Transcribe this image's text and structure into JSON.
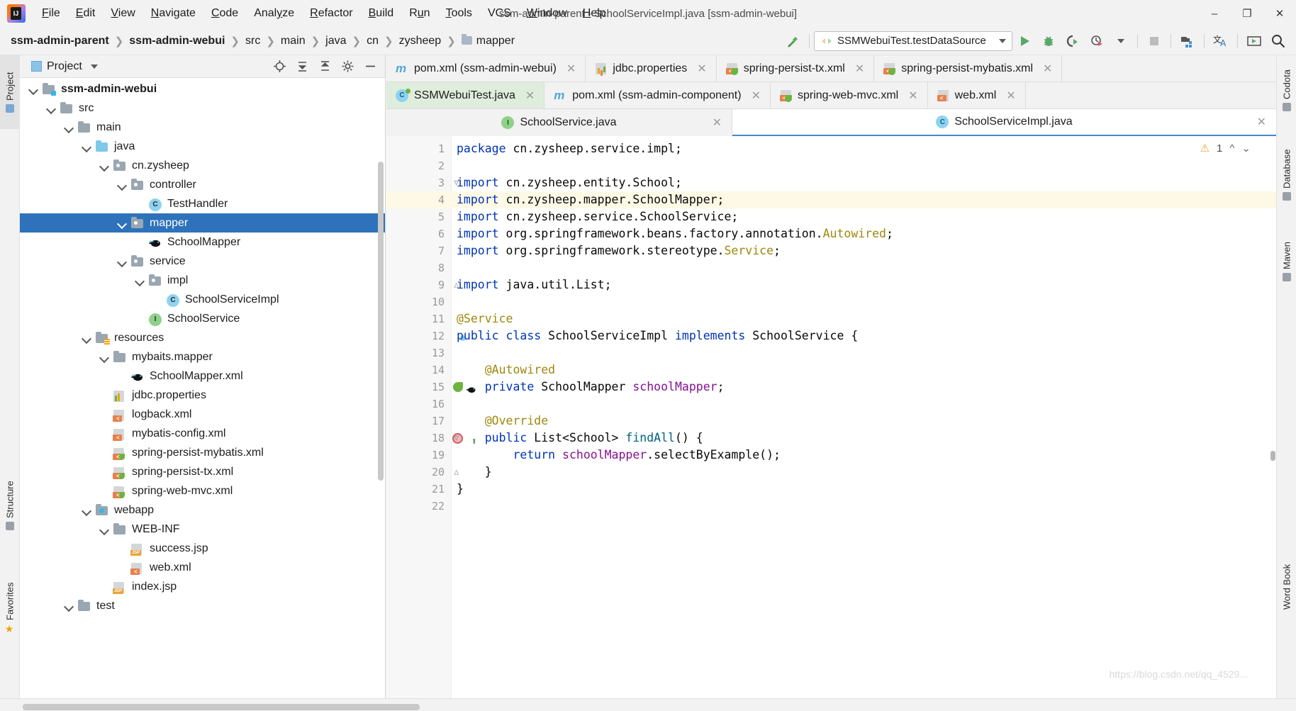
{
  "window": {
    "title": "ssm-admin-parent - SchoolServiceImpl.java [ssm-admin-webui]",
    "minimize": "–",
    "maximize": "❐",
    "close": "✕",
    "logo": "intellij-idea-logo"
  },
  "menu": {
    "items": [
      {
        "label": "File",
        "mnemonic": "F"
      },
      {
        "label": "Edit",
        "mnemonic": "E"
      },
      {
        "label": "View",
        "mnemonic": "V"
      },
      {
        "label": "Navigate",
        "mnemonic": "N"
      },
      {
        "label": "Code",
        "mnemonic": "C"
      },
      {
        "label": "Analyze",
        "mnemonic": "y"
      },
      {
        "label": "Refactor",
        "mnemonic": "R"
      },
      {
        "label": "Build",
        "mnemonic": "B"
      },
      {
        "label": "Run",
        "mnemonic": "u"
      },
      {
        "label": "Tools",
        "mnemonic": "T"
      },
      {
        "label": "VCS",
        "mnemonic": ""
      },
      {
        "label": "Window",
        "mnemonic": "W"
      },
      {
        "label": "Help",
        "mnemonic": "H"
      }
    ]
  },
  "breadcrumbs": [
    {
      "label": "ssm-admin-parent",
      "bold": true,
      "folder": false
    },
    {
      "label": "ssm-admin-webui",
      "bold": true,
      "folder": false
    },
    {
      "label": "src",
      "bold": false,
      "folder": false
    },
    {
      "label": "main",
      "bold": false,
      "folder": false
    },
    {
      "label": "java",
      "bold": false,
      "folder": false
    },
    {
      "label": "cn",
      "bold": false,
      "folder": false
    },
    {
      "label": "zysheep",
      "bold": false,
      "folder": false
    },
    {
      "label": "mapper",
      "bold": false,
      "folder": true
    }
  ],
  "toolbar": {
    "build_icon": "hammer-icon",
    "run_config": "SSMWebuiTest.testDataSource",
    "run_icon": "run-icon",
    "debug_icon": "debug-icon",
    "run_coverage_icon": "run-with-coverage-icon",
    "profile_icon": "profiler-icon",
    "dropdown_icon": "chevron-down-icon",
    "stop_icon": "stop-icon",
    "project_structure_icon": "project-structure-icon",
    "translate_icon": "translate-icon",
    "tomcat_icon": "deploy-icon",
    "search_icon": "search-icon"
  },
  "left_strip": [
    {
      "label": "Project",
      "icon": "project-icon",
      "selected": true
    },
    {
      "label": "Structure",
      "icon": "structure-icon",
      "selected": false
    },
    {
      "label": "Favorites",
      "icon": "star-icon",
      "selected": false
    }
  ],
  "right_strip": [
    {
      "label": "Codota",
      "icon": "codota-icon"
    },
    {
      "label": "Database",
      "icon": "database-icon"
    },
    {
      "label": "Maven",
      "icon": "maven-icon"
    },
    {
      "label": "Word Book",
      "icon": "wordbook-icon"
    }
  ],
  "project_panel": {
    "title": "Project",
    "chevron": "▾",
    "header_icons": [
      "locate-icon",
      "collapse-all-icon",
      "expand-all-icon",
      "settings-icon",
      "hide-icon"
    ],
    "tree": [
      {
        "label": "ssm-admin-webui",
        "depth": 1,
        "icon": "module-folder",
        "arrow": true,
        "bold": true,
        "selected": false
      },
      {
        "label": "src",
        "depth": 2,
        "icon": "folder-gray",
        "arrow": true,
        "bold": false,
        "selected": false
      },
      {
        "label": "main",
        "depth": 3,
        "icon": "folder-gray",
        "arrow": true,
        "bold": false,
        "selected": false
      },
      {
        "label": "java",
        "depth": 4,
        "icon": "folder-source",
        "arrow": true,
        "bold": false,
        "selected": false
      },
      {
        "label": "cn.zysheep",
        "depth": 5,
        "icon": "package",
        "arrow": true,
        "bold": false,
        "selected": false
      },
      {
        "label": "controller",
        "depth": 6,
        "icon": "package",
        "arrow": true,
        "bold": false,
        "selected": false
      },
      {
        "label": "TestHandler",
        "depth": 7,
        "icon": "java-class",
        "arrow": false,
        "bold": false,
        "selected": false
      },
      {
        "label": "mapper",
        "depth": 6,
        "icon": "package",
        "arrow": true,
        "bold": false,
        "selected": true
      },
      {
        "label": "SchoolMapper",
        "depth": 7,
        "icon": "mybatis-mapper",
        "arrow": false,
        "bold": false,
        "selected": false
      },
      {
        "label": "service",
        "depth": 6,
        "icon": "package",
        "arrow": true,
        "bold": false,
        "selected": false
      },
      {
        "label": "impl",
        "depth": 7,
        "icon": "package",
        "arrow": true,
        "bold": false,
        "selected": false
      },
      {
        "label": "SchoolServiceImpl",
        "depth": 8,
        "icon": "java-class",
        "arrow": false,
        "bold": false,
        "selected": false
      },
      {
        "label": "SchoolService",
        "depth": 7,
        "icon": "java-interface",
        "arrow": false,
        "bold": false,
        "selected": false
      },
      {
        "label": "resources",
        "depth": 4,
        "icon": "folder-resources",
        "arrow": true,
        "bold": false,
        "selected": false
      },
      {
        "label": "mybaits.mapper",
        "depth": 5,
        "icon": "folder-gray",
        "arrow": true,
        "bold": false,
        "selected": false
      },
      {
        "label": "SchoolMapper.xml",
        "depth": 6,
        "icon": "mybatis-xml",
        "arrow": false,
        "bold": false,
        "selected": false
      },
      {
        "label": "jdbc.properties",
        "depth": 5,
        "icon": "properties-file",
        "arrow": false,
        "bold": false,
        "selected": false
      },
      {
        "label": "logback.xml",
        "depth": 5,
        "icon": "xml-file",
        "arrow": false,
        "bold": false,
        "selected": false
      },
      {
        "label": "mybatis-config.xml",
        "depth": 5,
        "icon": "xml-file",
        "arrow": false,
        "bold": false,
        "selected": false
      },
      {
        "label": "spring-persist-mybatis.xml",
        "depth": 5,
        "icon": "spring-xml",
        "arrow": false,
        "bold": false,
        "selected": false
      },
      {
        "label": "spring-persist-tx.xml",
        "depth": 5,
        "icon": "spring-xml",
        "arrow": false,
        "bold": false,
        "selected": false
      },
      {
        "label": "spring-web-mvc.xml",
        "depth": 5,
        "icon": "spring-xml",
        "arrow": false,
        "bold": false,
        "selected": false
      },
      {
        "label": "webapp",
        "depth": 4,
        "icon": "folder-web",
        "arrow": true,
        "bold": false,
        "selected": false
      },
      {
        "label": "WEB-INF",
        "depth": 5,
        "icon": "folder-gray",
        "arrow": true,
        "bold": false,
        "selected": false
      },
      {
        "label": "success.jsp",
        "depth": 6,
        "icon": "jsp-file",
        "arrow": false,
        "bold": false,
        "selected": false
      },
      {
        "label": "web.xml",
        "depth": 6,
        "icon": "xml-file",
        "arrow": false,
        "bold": false,
        "selected": false
      },
      {
        "label": "index.jsp",
        "depth": 5,
        "icon": "jsp-file",
        "arrow": false,
        "bold": false,
        "selected": false
      },
      {
        "label": "test",
        "depth": 3,
        "icon": "folder-gray",
        "arrow": true,
        "bold": false,
        "selected": false
      }
    ]
  },
  "editor": {
    "tab_rows": [
      [
        {
          "label": "pom.xml (ssm-admin-webui)",
          "icon": "maven-icon",
          "active": false,
          "closable": true
        },
        {
          "label": "jdbc.properties",
          "icon": "properties-icon",
          "active": false,
          "closable": true
        },
        {
          "label": "spring-persist-tx.xml",
          "icon": "spring-icon",
          "active": false,
          "closable": true
        },
        {
          "label": "spring-persist-mybatis.xml",
          "icon": "spring-icon",
          "active": false,
          "closable": true
        }
      ],
      [
        {
          "label": "SSMWebuiTest.java",
          "icon": "java-test-class-icon",
          "active": true,
          "closable": true
        },
        {
          "label": "pom.xml (ssm-admin-component)",
          "icon": "maven-icon",
          "active": false,
          "closable": true
        },
        {
          "label": "spring-web-mvc.xml",
          "icon": "spring-icon",
          "active": false,
          "closable": true
        },
        {
          "label": "web.xml",
          "icon": "xml-icon",
          "active": false,
          "closable": true
        }
      ]
    ],
    "split_tabs": [
      {
        "label": "SchoolService.java",
        "icon": "java-interface-icon",
        "active": false,
        "closable": true
      },
      {
        "label": "SchoolServiceImpl.java",
        "icon": "java-class-icon",
        "active": true,
        "closable": true
      }
    ],
    "inspection": {
      "warning_count": "1",
      "warning_icon": "warning-triangle-icon",
      "prev_icon": "chevron-up-icon",
      "next_icon": "chevron-down-icon"
    },
    "lines": [
      {
        "n": "1",
        "highlight": false,
        "fold": "",
        "gutter": "",
        "tokens": [
          {
            "t": "package ",
            "c": "kw"
          },
          {
            "t": "cn.zysheep.service.impl;",
            "c": ""
          }
        ]
      },
      {
        "n": "2",
        "highlight": false,
        "fold": "",
        "gutter": "",
        "tokens": []
      },
      {
        "n": "3",
        "highlight": false,
        "fold": "minus",
        "gutter": "",
        "tokens": [
          {
            "t": "import ",
            "c": "kw"
          },
          {
            "t": "cn.zysheep.entity.School;",
            "c": ""
          }
        ]
      },
      {
        "n": "4",
        "highlight": true,
        "fold": "",
        "gutter": "",
        "tokens": [
          {
            "t": "import ",
            "c": "kw"
          },
          {
            "t": "cn.zysheep.mapper.SchoolMapper;",
            "c": ""
          }
        ]
      },
      {
        "n": "5",
        "highlight": false,
        "fold": "",
        "gutter": "",
        "tokens": [
          {
            "t": "import ",
            "c": "kw"
          },
          {
            "t": "cn.zysheep.service.SchoolService;",
            "c": ""
          }
        ]
      },
      {
        "n": "6",
        "highlight": false,
        "fold": "",
        "gutter": "",
        "tokens": [
          {
            "t": "import ",
            "c": "kw"
          },
          {
            "t": "org.springframework.beans.factory.annotation.",
            "c": ""
          },
          {
            "t": "Autowired",
            "c": "ann"
          },
          {
            "t": ";",
            "c": ""
          }
        ]
      },
      {
        "n": "7",
        "highlight": false,
        "fold": "",
        "gutter": "",
        "tokens": [
          {
            "t": "import ",
            "c": "kw"
          },
          {
            "t": "org.springframework.stereotype.",
            "c": ""
          },
          {
            "t": "Service",
            "c": "ann"
          },
          {
            "t": ";",
            "c": ""
          }
        ]
      },
      {
        "n": "8",
        "highlight": false,
        "fold": "",
        "gutter": "",
        "tokens": []
      },
      {
        "n": "9",
        "highlight": false,
        "fold": "end",
        "gutter": "",
        "tokens": [
          {
            "t": "import ",
            "c": "kw"
          },
          {
            "t": "java.util.List;",
            "c": ""
          }
        ]
      },
      {
        "n": "10",
        "highlight": false,
        "fold": "",
        "gutter": "",
        "tokens": []
      },
      {
        "n": "11",
        "highlight": false,
        "fold": "",
        "gutter": "",
        "tokens": [
          {
            "t": "@Service",
            "c": "ann"
          }
        ]
      },
      {
        "n": "12",
        "highlight": false,
        "fold": "",
        "gutter": "impl",
        "tokens": [
          {
            "t": "public ",
            "c": "kw"
          },
          {
            "t": "class ",
            "c": "kw"
          },
          {
            "t": "SchoolServiceImpl ",
            "c": ""
          },
          {
            "t": "implements ",
            "c": "kw"
          },
          {
            "t": "SchoolService {",
            "c": ""
          }
        ]
      },
      {
        "n": "13",
        "highlight": false,
        "fold": "",
        "gutter": "",
        "tokens": []
      },
      {
        "n": "14",
        "highlight": false,
        "fold": "",
        "gutter": "",
        "tokens": [
          {
            "t": "    @Autowired",
            "c": "ann"
          }
        ]
      },
      {
        "n": "15",
        "highlight": false,
        "fold": "",
        "gutter": "bean",
        "tokens": [
          {
            "t": "    private ",
            "c": "kw"
          },
          {
            "t": "SchoolMapper ",
            "c": ""
          },
          {
            "t": "schoolMapper",
            "c": "fld"
          },
          {
            "t": ";",
            "c": ""
          }
        ]
      },
      {
        "n": "16",
        "highlight": false,
        "fold": "",
        "gutter": "",
        "tokens": []
      },
      {
        "n": "17",
        "highlight": false,
        "fold": "",
        "gutter": "",
        "tokens": [
          {
            "t": "    @Override",
            "c": "ann"
          }
        ]
      },
      {
        "n": "18",
        "highlight": false,
        "fold": "minus",
        "gutter": "run",
        "tokens": [
          {
            "t": "    public ",
            "c": "kw"
          },
          {
            "t": "List<School> ",
            "c": ""
          },
          {
            "t": "findAll",
            "c": "mth"
          },
          {
            "t": "() {",
            "c": ""
          }
        ]
      },
      {
        "n": "19",
        "highlight": false,
        "fold": "",
        "gutter": "",
        "tokens": [
          {
            "t": "        return ",
            "c": "kw"
          },
          {
            "t": "schoolMapper",
            "c": "fld"
          },
          {
            "t": ".selectByExample();",
            "c": ""
          }
        ]
      },
      {
        "n": "20",
        "highlight": false,
        "fold": "end",
        "gutter": "",
        "tokens": [
          {
            "t": "    }",
            "c": ""
          }
        ]
      },
      {
        "n": "21",
        "highlight": false,
        "fold": "",
        "gutter": "",
        "tokens": [
          {
            "t": "}",
            "c": ""
          }
        ]
      },
      {
        "n": "22",
        "highlight": false,
        "fold": "",
        "gutter": "",
        "tokens": []
      }
    ]
  },
  "watermark": "https://blog.csdn.net/qq_4529...",
  "colors": {
    "selection_blue": "#2d72ba",
    "active_tab_green": "#dfeddc",
    "keyword_blue": "#0033b3",
    "annotation_gold": "#9e880d",
    "field_purple": "#871094",
    "method_teal": "#00627a",
    "highlight_line": "#fdf9e6"
  }
}
